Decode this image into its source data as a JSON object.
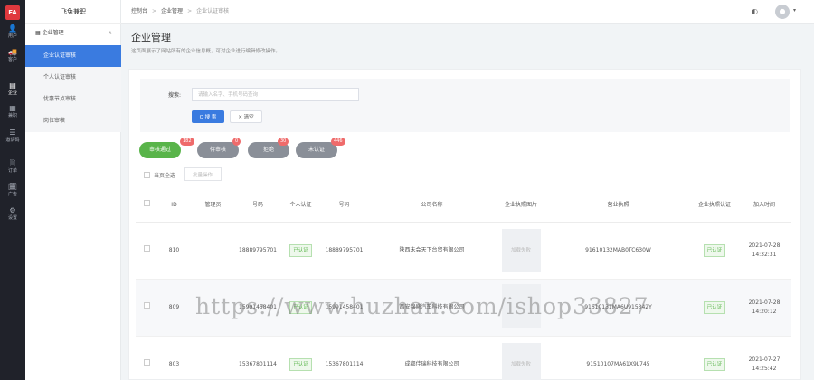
{
  "logo": "FA",
  "rail": [
    {
      "icon": "👤",
      "label": "用户"
    },
    {
      "icon": "🚚",
      "label": "客户"
    },
    {
      "icon": "▤",
      "label": "企业"
    },
    {
      "icon": "▦",
      "label": "兼职"
    },
    {
      "icon": "☰",
      "label": "邀请码"
    },
    {
      "icon": "🗎",
      "label": "订单"
    },
    {
      "icon": "🗓",
      "label": "广告"
    },
    {
      "icon": "⚙",
      "label": "设置"
    }
  ],
  "app_name": "飞兔兼职",
  "sidebar": {
    "group": "企业管理",
    "items": [
      "企业认证审核",
      "个人认证审核",
      "优惠节点审核",
      "岗位审核"
    ]
  },
  "breadcrumb": [
    "控制台",
    "企业管理",
    "企业认证审核"
  ],
  "page": {
    "title": "企业管理",
    "desc": "这页面展示了网站所有的企业信息概，可对企业进行编辑修改操作。"
  },
  "filter": {
    "keyword_label": "搜索:",
    "keyword_placeholder": "请输入名字、手机号码查询",
    "search_label": "Q 搜 索",
    "clear_label": "✕ 清空"
  },
  "tabs": [
    {
      "label": "审核通过",
      "badge": "182"
    },
    {
      "label": "待审核",
      "badge": "0"
    },
    {
      "label": "拒绝",
      "badge": "30"
    },
    {
      "label": "未认证",
      "badge": "446"
    }
  ],
  "select_all_label": "当页全选",
  "batch_label": "批量操作",
  "table": {
    "headers": [
      "ID",
      "管理员",
      "号码",
      "个人认证",
      "号码",
      "公司名称",
      "企业执照图片",
      "营业执照",
      "企业执照认证",
      "加入时间"
    ],
    "rows": [
      {
        "id": "810",
        "admin": "",
        "phone": "18889795701",
        "personal": "已认证",
        "phone2": "18889795701",
        "company": "陕西未会天下台贸有限公司",
        "img": "加载失败",
        "license": "91610132MAB0TC630W",
        "verified": "已认证",
        "joined": "2021-07-28 14:32:31"
      },
      {
        "id": "809",
        "admin": "",
        "phone": "15991458401",
        "personal": "已认证",
        "phone2": "15991458401",
        "company": "西安锦盛汽车科技有限公司",
        "img": "",
        "license": "91610131MA6U915342Y",
        "verified": "已认证",
        "joined": "2021-07-28 14:20:12"
      },
      {
        "id": "803",
        "admin": "",
        "phone": "15367801114",
        "personal": "已认证",
        "phone2": "15367801114",
        "company": "成都佳瑞科技有限公司",
        "img": "加载失败",
        "license": "91510107MA61X9L745",
        "verified": "已认证",
        "joined": "2021-07-27 14:25:42"
      }
    ]
  },
  "watermark": "https://www.huzhan.com/ishop33827"
}
